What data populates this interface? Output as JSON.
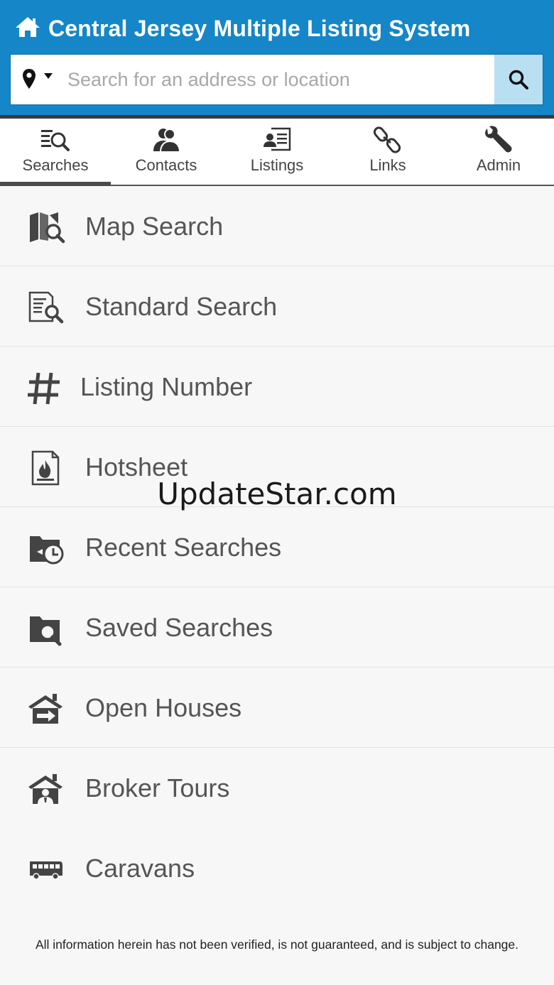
{
  "header": {
    "title": "Central Jersey Multiple Listing System",
    "search": {
      "placeholder": "Search for an address or location",
      "value": ""
    },
    "colors": {
      "bar": "#1586c7",
      "search_button": "#b9dff3"
    }
  },
  "tabs": [
    {
      "label": "Searches",
      "icon": "search-list-icon",
      "active": true
    },
    {
      "label": "Contacts",
      "icon": "contacts-icon",
      "active": false
    },
    {
      "label": "Listings",
      "icon": "listings-icon",
      "active": false
    },
    {
      "label": "Links",
      "icon": "chain-link-icon",
      "active": false
    },
    {
      "label": "Admin",
      "icon": "wrench-icon",
      "active": false
    }
  ],
  "menu": [
    {
      "label": "Map Search",
      "icon": "map-search-icon"
    },
    {
      "label": "Standard Search",
      "icon": "document-search-icon"
    },
    {
      "label": "Listing Number",
      "icon": "hash-icon"
    },
    {
      "label": "Hotsheet",
      "icon": "hotsheet-fire-icon"
    },
    {
      "label": "Recent Searches",
      "icon": "folder-clock-icon"
    },
    {
      "label": "Saved Searches",
      "icon": "folder-search-icon"
    },
    {
      "label": "Open Houses",
      "icon": "house-arrow-icon"
    },
    {
      "label": "Broker Tours",
      "icon": "house-person-icon"
    },
    {
      "label": "Caravans",
      "icon": "bus-icon"
    }
  ],
  "watermark": "UpdateStar.com",
  "disclaimer": "All information herein has not been verified, is not guaranteed, and is subject to change."
}
